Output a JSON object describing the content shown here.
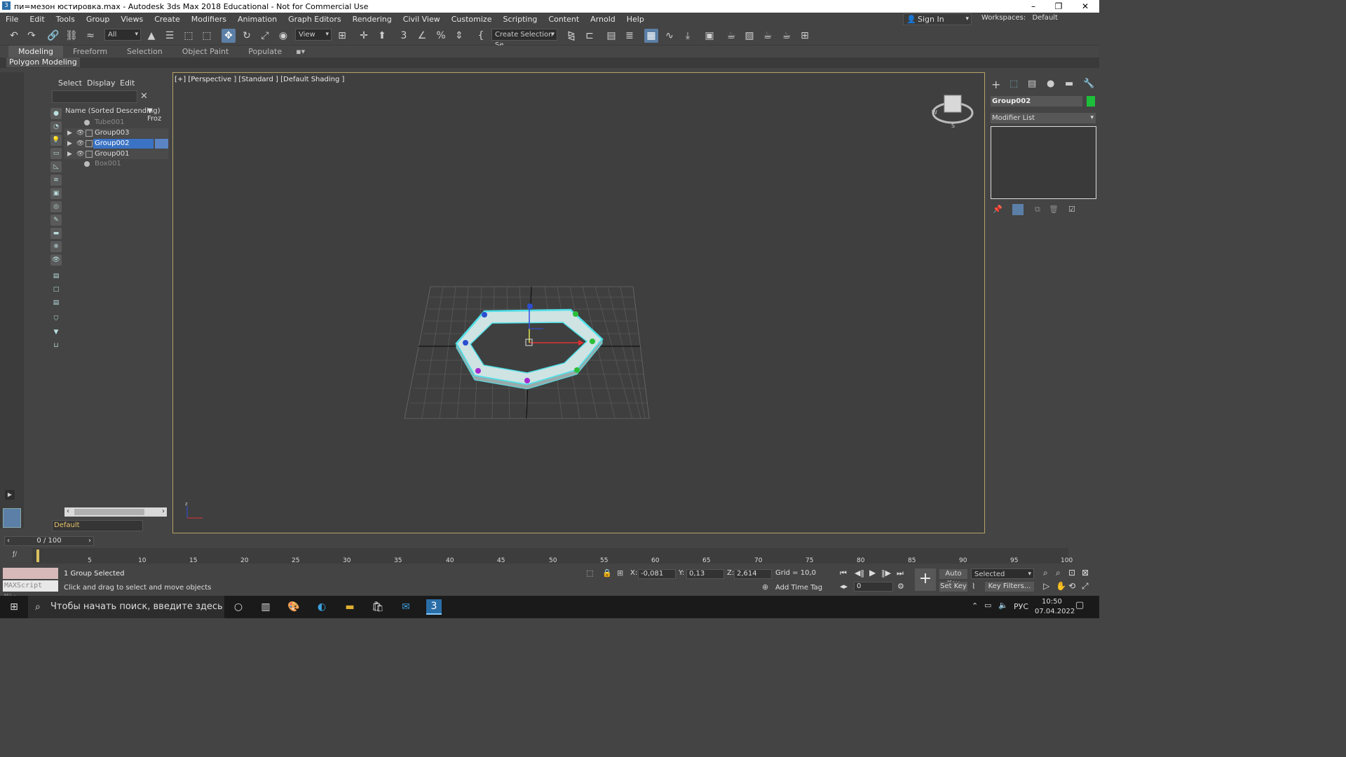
{
  "window": {
    "title": "пи=мезон юстировка.max - Autodesk 3ds Max 2018 Educational - Not for Commercial Use",
    "minimize": "–",
    "restore": "❐",
    "close": "✕"
  },
  "menu": [
    "File",
    "Edit",
    "Tools",
    "Group",
    "Views",
    "Create",
    "Modifiers",
    "Animation",
    "Graph Editors",
    "Rendering",
    "Civil View",
    "Customize",
    "Scripting",
    "Content",
    "Arnold",
    "Help"
  ],
  "signin": {
    "label": "Sign In"
  },
  "workspace": {
    "label": "Workspaces:",
    "value": "Default"
  },
  "toolbar": {
    "filter_value": "All",
    "refcoord_value": "View",
    "selection_set_value": "Create Selection Se"
  },
  "ribbon": {
    "tabs": [
      "Modeling",
      "Freeform",
      "Selection",
      "Object Paint",
      "Populate"
    ],
    "active_tab": "Modeling",
    "panel_label": "Polygon Modeling"
  },
  "scene_explorer": {
    "tabs": [
      "Select",
      "Display",
      "Edit"
    ],
    "search_value": "",
    "column_name": "Name (Sorted Descending)",
    "column_frozen": "▼ Froz",
    "rows": [
      {
        "name": "Tube001",
        "state": "hidden"
      },
      {
        "name": "Group003",
        "state": "group"
      },
      {
        "name": "Group002",
        "state": "selected"
      },
      {
        "name": "Group001",
        "state": "group"
      },
      {
        "name": "Box001",
        "state": "hidden"
      }
    ],
    "layer_value": "Default"
  },
  "viewport": {
    "label": "[+] [Perspective ] [Standard ] [Default Shading ]"
  },
  "command_panel": {
    "object_name": "Group002",
    "object_color": "#1dbf3a",
    "modifier_list": "Modifier List"
  },
  "time": {
    "frame_slider": "0 / 100",
    "ticks": [
      "5",
      "10",
      "15",
      "20",
      "25",
      "30",
      "35",
      "40",
      "45",
      "50",
      "55",
      "60",
      "65",
      "70",
      "75",
      "80",
      "85",
      "90",
      "95",
      "100"
    ]
  },
  "status": {
    "selection": "1 Group Selected",
    "prompt": "Click and drag to select and move objects",
    "maxscript": "MAXScript Mi:",
    "x_label": "X:",
    "x_value": "-0,081",
    "y_label": "Y:",
    "y_value": "0,13",
    "z_label": "Z:",
    "z_value": "2,614",
    "grid": "Grid = 10,0",
    "add_time_tag": "Add Time Tag",
    "auto_key": "Auto Key",
    "set_key": "Set Key",
    "selected_dd": "Selected",
    "key_filters": "Key Filters...",
    "frame_value": "0"
  },
  "taskbar": {
    "search_placeholder": "Чтобы начать поиск, введите здесь",
    "lang": "РУС",
    "time": "10:50",
    "date": "07.04.2022"
  },
  "colors": {
    "accent": "#5b7fa6",
    "viewport_border": "#b5a369",
    "selection_cyan": "#4fe0e8"
  }
}
